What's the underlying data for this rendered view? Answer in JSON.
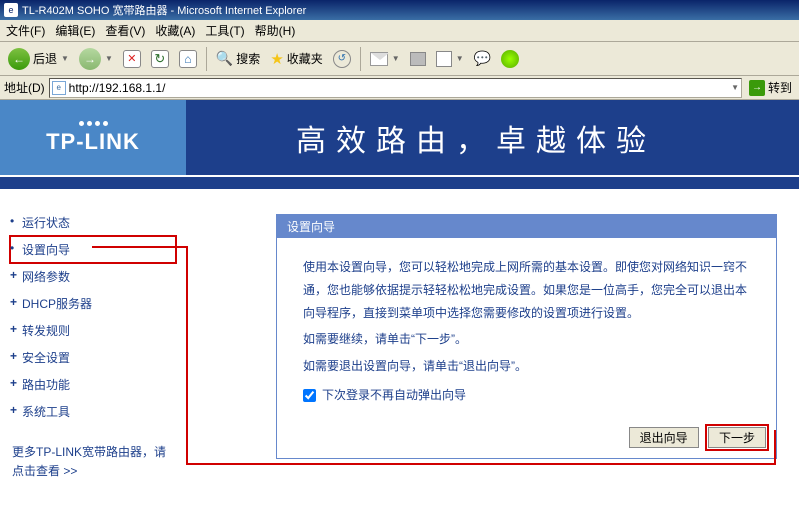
{
  "window": {
    "title": "TL-R402M SOHO 宽带路由器 - Microsoft Internet Explorer"
  },
  "menu": {
    "file": "文件(F)",
    "edit": "编辑(E)",
    "view": "查看(V)",
    "fav": "收藏(A)",
    "tools": "工具(T)",
    "help": "帮助(H)"
  },
  "toolbar": {
    "back": "后退",
    "search": "搜索",
    "fav": "收藏夹"
  },
  "address": {
    "label": "地址(D)",
    "url": "http://192.168.1.1/",
    "go": "转到"
  },
  "header": {
    "brand": "TP-LINK",
    "slogan": "高效路由，卓越体验"
  },
  "sidebar": {
    "items": [
      {
        "label": "运行状态",
        "expandable": false
      },
      {
        "label": "设置向导",
        "expandable": false,
        "selected": true
      },
      {
        "label": "网络参数",
        "expandable": true
      },
      {
        "label": "DHCP服务器",
        "expandable": true
      },
      {
        "label": "转发规则",
        "expandable": true
      },
      {
        "label": "安全设置",
        "expandable": true
      },
      {
        "label": "路由功能",
        "expandable": true
      },
      {
        "label": "系统工具",
        "expandable": true
      }
    ],
    "more": "更多TP-LINK宽带路由器，请点击查看 >>"
  },
  "panel": {
    "title": "设置向导",
    "p1": "使用本设置向导，您可以轻松地完成上网所需的基本设置。即使您对网络知识一窍不通，您也能够依据提示轻轻松松地完成设置。如果您是一位高手，您完全可以退出本向导程序，直接到菜单项中选择您需要修改的设置项进行设置。",
    "p2": "如需要继续，请单击“下一步”。",
    "p3": "如需要退出设置向导，请单击“退出向导”。",
    "checkbox": "下次登录不再自动弹出向导",
    "btn_exit": "退出向导",
    "btn_next": "下一步"
  }
}
